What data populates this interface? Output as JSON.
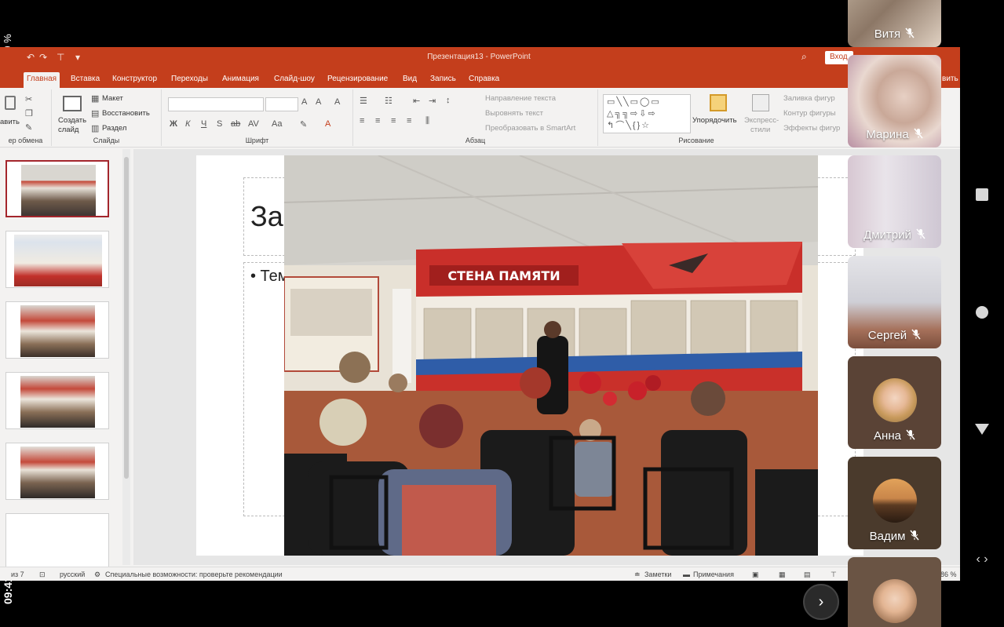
{
  "status": {
    "battery": "30 %",
    "time": "09:41"
  },
  "ppt": {
    "window_title": "Презентация13  -  PowerPoint",
    "signin": "Вход",
    "tabs": [
      "Главная",
      "Вставка",
      "Конструктор",
      "Переходы",
      "Анимация",
      "Слайд-шоу",
      "Рецензирование",
      "Вид",
      "Запись",
      "Справка"
    ],
    "tab_cut_right": "вить",
    "ribbon": {
      "clipboard_paste": "авить",
      "clipboard_label": "ер обмена",
      "new_slide": "Создать",
      "new_slide2": "слайд",
      "layout": "Макет",
      "reset": "Восстановить",
      "section": "Раздел",
      "slides_label": "Слайды",
      "font_label": "Шрифт",
      "para_direction": "Направление текста",
      "para_align": "Выровнять текст",
      "para_smartart": "Преобразовать в SmartArt",
      "para_label": "Абзац",
      "arrange": "Упорядочить",
      "quick_styles": "Экспресс-",
      "quick_styles2": "стили",
      "fill": "Заливка фигур",
      "outline": "Контур фигуры",
      "effects": "Эффекты фигур",
      "drawing_label": "Рисование"
    },
    "slide": {
      "title_fragment": "Зав",
      "body_fragment": "• Тем"
    },
    "photo": {
      "banner": "СТЕНА ПАМЯТИ"
    },
    "statusbar": {
      "slide_of": "из 7",
      "language": "русский",
      "accessibility": "Специальные возможности: проверьте рекомендации",
      "notes": "Заметки",
      "comments": "Примечания",
      "zoom": "86 %"
    }
  },
  "participants": [
    {
      "name": "Витя"
    },
    {
      "name": "Марина"
    },
    {
      "name": "Дмитрий"
    },
    {
      "name": "Сергей"
    },
    {
      "name": "Анна"
    },
    {
      "name": "Вадим"
    },
    {
      "name": ""
    }
  ],
  "colors": {
    "ppt_accent": "#c43e1c",
    "slide_selected": "#a4262c"
  }
}
